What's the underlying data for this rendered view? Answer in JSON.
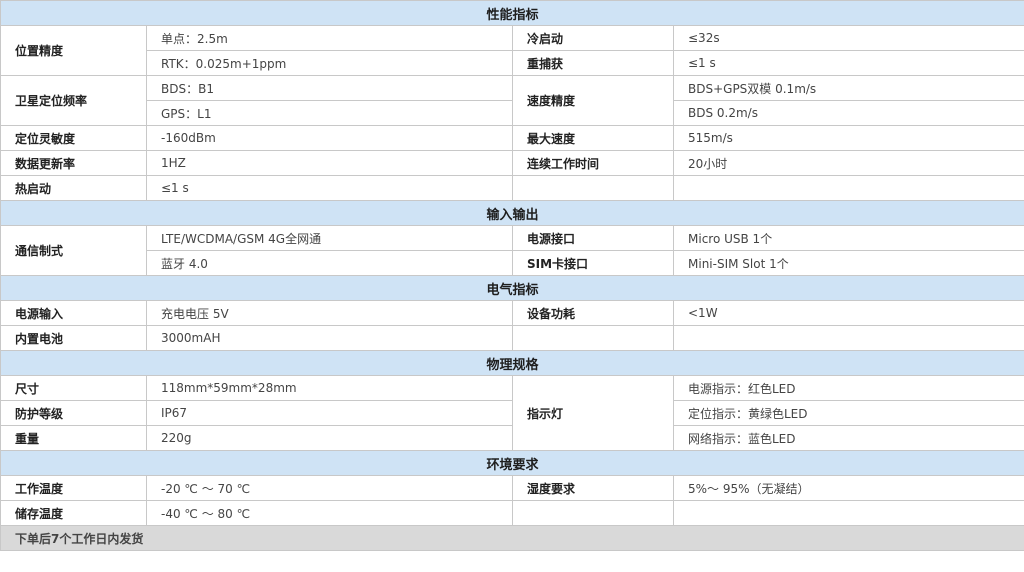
{
  "sections": {
    "performance": {
      "title": "性能指标",
      "position_accuracy": {
        "label": "位置精度",
        "v1": "单点：2.5m",
        "v2": "RTK：0.025m+1ppm"
      },
      "cold_start": {
        "label": "冷启动",
        "value": "≤32s"
      },
      "reacquisition": {
        "label": "重捕获",
        "value": "≤1 s"
      },
      "sat_freq": {
        "label": "卫星定位频率",
        "v1": "BDS：B1",
        "v2": "GPS：L1"
      },
      "speed_accuracy": {
        "label": "速度精度",
        "v1": "BDS+GPS双模 0.1m/s",
        "v2": "BDS 0.2m/s"
      },
      "sensitivity": {
        "label": "定位灵敏度",
        "value": "-160dBm"
      },
      "max_speed": {
        "label": "最大速度",
        "value": "515m/s"
      },
      "update_rate": {
        "label": "数据更新率",
        "value": "1HZ"
      },
      "work_time": {
        "label": "连续工作时间",
        "value": "20小时"
      },
      "hot_start": {
        "label": "热启动",
        "value": "≤1 s"
      }
    },
    "io": {
      "title": "输入输出",
      "comm": {
        "label": "通信制式",
        "v1": "LTE/WCDMA/GSM 4G全网通",
        "v2": "蓝牙 4.0"
      },
      "power_port": {
        "label": "电源接口",
        "value": "Micro USB 1个"
      },
      "sim_port": {
        "label": "SIM卡接口",
        "value": "Mini-SIM Slot 1个"
      }
    },
    "electrical": {
      "title": "电气指标",
      "power_input": {
        "label": "电源输入",
        "value": "充电电压  5V"
      },
      "power_consumption": {
        "label": "设备功耗",
        "value": "<1W"
      },
      "battery": {
        "label": "内置电池",
        "value": "3000mAH"
      }
    },
    "physical": {
      "title": "物理规格",
      "size": {
        "label": "尺寸",
        "value": "118mm*59mm*28mm"
      },
      "protection": {
        "label": "防护等级",
        "value": "IP67"
      },
      "weight": {
        "label": "重量",
        "value": "220g"
      },
      "indicator": {
        "label": "指示灯",
        "power": "电源指示：红色LED",
        "position": "定位指示：黄绿色LED",
        "network": "网络指示：蓝色LED"
      }
    },
    "environment": {
      "title": "环境要求",
      "work_temp": {
        "label": "工作温度",
        "value": "-20 ℃ ～ 70 ℃"
      },
      "humidity": {
        "label": "湿度要求",
        "value": "5%～ 95%（无凝结）"
      },
      "storage_temp": {
        "label": "储存温度",
        "value": "-40 ℃ ～ 80 ℃"
      }
    }
  },
  "footer": {
    "text": "下单后7个工作日内发货"
  }
}
